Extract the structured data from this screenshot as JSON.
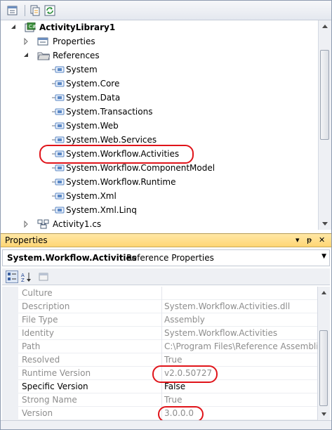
{
  "solution_explorer": {
    "tree": [
      {
        "label": "ActivityLibrary1",
        "icon": "csharp-project-icon",
        "expander": "expanded",
        "bold": true
      },
      {
        "label": "Properties",
        "icon": "properties-folder-icon",
        "expander": "collapsed"
      },
      {
        "label": "References",
        "icon": "references-folder-icon",
        "expander": "expanded"
      },
      {
        "label": "System",
        "icon": "reference-icon"
      },
      {
        "label": "System.Core",
        "icon": "reference-icon"
      },
      {
        "label": "System.Data",
        "icon": "reference-icon"
      },
      {
        "label": "System.Transactions",
        "icon": "reference-icon"
      },
      {
        "label": "System.Web",
        "icon": "reference-icon"
      },
      {
        "label": "System.Web.Services",
        "icon": "reference-icon"
      },
      {
        "label": "System.Workflow.Activities",
        "icon": "reference-icon",
        "highlighted": true
      },
      {
        "label": "System.Workflow.ComponentModel",
        "icon": "reference-icon"
      },
      {
        "label": "System.Workflow.Runtime",
        "icon": "reference-icon"
      },
      {
        "label": "System.Xml",
        "icon": "reference-icon"
      },
      {
        "label": "System.Xml.Linq",
        "icon": "reference-icon"
      },
      {
        "label": "Activity1.cs",
        "icon": "workflow-file-icon",
        "expander": "collapsed"
      }
    ]
  },
  "properties": {
    "title": "Properties",
    "header_glyphs": {
      "dropdown": "▾",
      "pin": "ᵽ",
      "close": "✕"
    },
    "object_name": "System.Workflow.Activities",
    "object_type": "Reference Properties",
    "rows": [
      {
        "name": "Culture",
        "value": "",
        "name_dark": false,
        "value_dark": false
      },
      {
        "name": "Description",
        "value": "System.Workflow.Activities.dll",
        "name_dark": false,
        "value_dark": false
      },
      {
        "name": "File Type",
        "value": "Assembly",
        "name_dark": false,
        "value_dark": false
      },
      {
        "name": "Identity",
        "value": "System.Workflow.Activities",
        "name_dark": false,
        "value_dark": false
      },
      {
        "name": "Path",
        "value": "C:\\Program Files\\Reference Assemblie",
        "name_dark": false,
        "value_dark": false
      },
      {
        "name": "Resolved",
        "value": "True",
        "name_dark": false,
        "value_dark": false
      },
      {
        "name": "Runtime Version",
        "value": "v2.0.50727",
        "name_dark": false,
        "value_dark": false
      },
      {
        "name": "Specific Version",
        "value": "False",
        "name_dark": true,
        "value_dark": true
      },
      {
        "name": "Strong Name",
        "value": "True",
        "name_dark": false,
        "value_dark": false
      },
      {
        "name": "Version",
        "value": "3.0.0.0",
        "name_dark": false,
        "value_dark": false
      }
    ]
  },
  "colors": {
    "annotation": "#e0141a",
    "header_gold": "#ffd674",
    "project_icon": "#3c8f3c",
    "reference_icon": "#5a87c5"
  }
}
